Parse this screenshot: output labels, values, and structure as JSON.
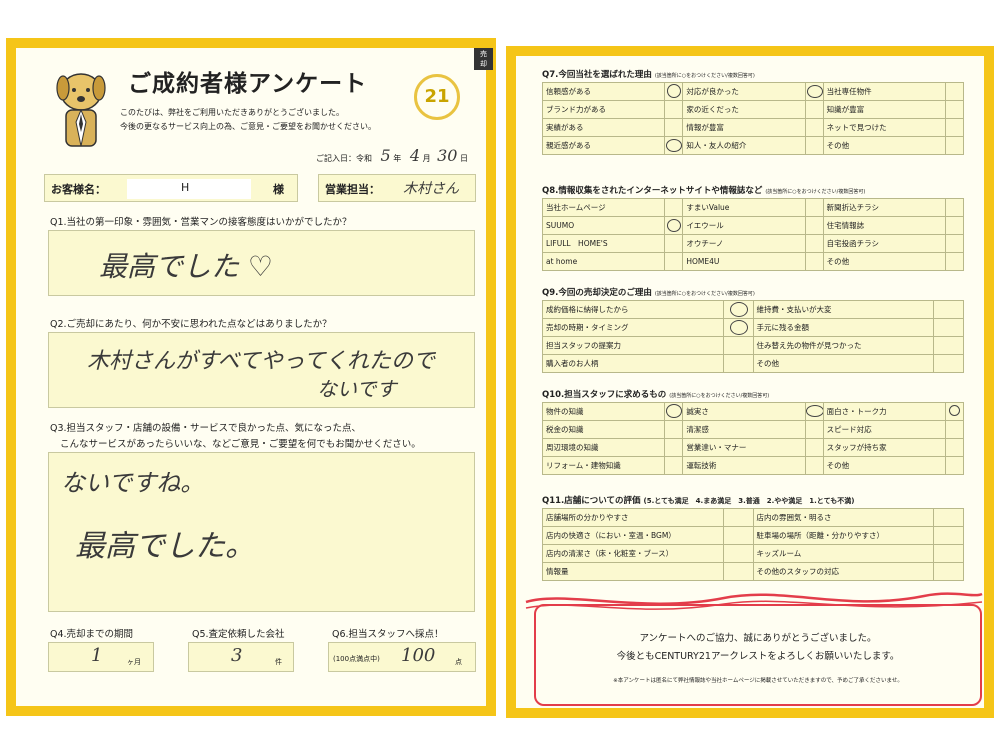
{
  "left": {
    "title": "ご成約者様アンケート",
    "logo_text": "21",
    "intro_line1": "このたびは、弊社をご利用いただきありがとうございました。",
    "intro_line2": "今後の更なるサービス向上の為、ご意見・ご要望をお聞かせください。",
    "date_label": "ご記入日：令和",
    "date_year": "5",
    "date_year_unit": "年",
    "date_month": "4",
    "date_month_unit": "月",
    "date_day": "30",
    "date_day_unit": "日",
    "customer_label": "お客様名：",
    "customer_name": "H",
    "customer_suffix": "様",
    "staff_label": "営業担当：",
    "staff_name": "木村さん",
    "q1": "Q1.当社の第一印象・雰囲気・営業マンの接客態度はいかがでしたか？",
    "a1": "最高でした ♡",
    "q2": "Q2.ご売却にあたり、何か不安に思われた点などはありましたか？",
    "a2_line1": "木村さんがすべてやってくれたので",
    "a2_line2": "ないです",
    "q3_line1": "Q3.担当スタッフ・店舗の設備・サービスで良かった点、気になった点、",
    "q3_line2": "こんなサービスがあったらいいな、などご意見・ご要望を何でもお聞かせください。",
    "a3_line1": "ないですね。",
    "a3_line2": "最高でした。",
    "q4": "Q4.売却までの期間",
    "a4": "1",
    "a4_unit": "ヶ月",
    "q5": "Q5.査定依頼した会社",
    "a5": "3",
    "a5_unit": "件",
    "q6": "Q6.担当スタッフへ採点！",
    "a6_prefix": "(100点満点中)",
    "a6": "100",
    "a6_unit": "点",
    "corner_tag": "売却"
  },
  "right": {
    "q7": {
      "title": "Q7.今回当社を選ばれた理由",
      "note": "(該当箇所に○をおつけください/複数回答可)",
      "rows": [
        [
          "信頼感がある",
          "対応が良かった",
          "当社専任物件"
        ],
        [
          "ブランド力がある",
          "家の近くだった",
          "知識が豊富"
        ],
        [
          "実績がある",
          "情報が豊富",
          "ネットで見つけた"
        ],
        [
          "親近感がある",
          "知人・友人の紹介",
          "その他"
        ]
      ]
    },
    "q8": {
      "title": "Q8.情報収集をされたインターネットサイトや情報誌など",
      "note": "(該当箇所に○をおつけください/複数回答可)",
      "rows": [
        [
          "当社ホームページ",
          "すまいValue",
          "新聞折込チラシ"
        ],
        [
          "SUUMO",
          "イエウール",
          "住宅情報誌"
        ],
        [
          "LIFULL　HOME'S",
          "オウチーノ",
          "自宅投函チラシ"
        ],
        [
          "at home",
          "HOME4U",
          "その他"
        ]
      ]
    },
    "q9": {
      "title": "Q9.今回の売却決定のご理由",
      "note": "(該当箇所に○をおつけください/複数回答可)",
      "rows": [
        [
          "成約価格に納得したから",
          "維持費・支払いが大変"
        ],
        [
          "売却の時期・タイミング",
          "手元に残る金額"
        ],
        [
          "担当スタッフの提案力",
          "住み替え先の物件が見つかった"
        ],
        [
          "購入者のお人柄",
          "その他"
        ]
      ]
    },
    "q10": {
      "title": "Q10.担当スタッフに求めるもの",
      "note": "(該当箇所に○をおつけください/複数回答可)",
      "rows": [
        [
          "物件の知識",
          "誠実さ",
          "面白さ・トーク力"
        ],
        [
          "税金の知識",
          "清潔感",
          "スピード対応"
        ],
        [
          "周辺環境の知識",
          "営業達い・マナー",
          "スタッフが持ち家"
        ],
        [
          "リフォーム・建物知識",
          "運転技術",
          "その他"
        ]
      ]
    },
    "q11": {
      "title": "Q11.店舗についての評価",
      "scale": "(5.とても満足　4.まあ満足　3.普通　2.やや満足　1.とても不満)",
      "rows": [
        [
          "店舗場所の分かりやすさ",
          "店内の雰囲気・明るさ"
        ],
        [
          "店内の快適さ（におい・室温・BGM）",
          "駐車場の場所（距離・分かりやすさ）"
        ],
        [
          "店内の清潔さ（床・化粧室・ブース）",
          "キッズルーム"
        ],
        [
          "情報量",
          "その他のスタッフの対応"
        ]
      ]
    },
    "thanks_line1": "アンケートへのご協力、誠にありがとうございました。",
    "thanks_line2": "今後ともCENTURY21アークレストをよろしくお願いいたします。",
    "thanks_note": "※本アンケートは匿名にて弊社情報誌や当社ホームページに掲載させていただきますので、予めご了承くださいませ。"
  },
  "colors": {
    "frame": "#f5c518",
    "answer_bg": "#fbf9d0",
    "ribbon": "#e33d4a"
  }
}
